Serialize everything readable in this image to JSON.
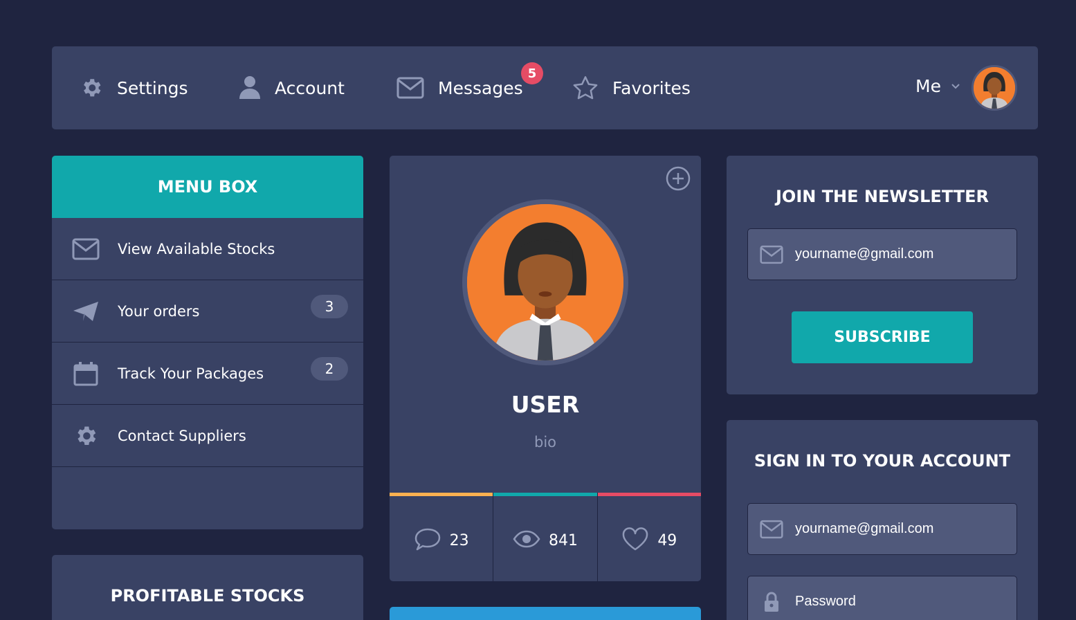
{
  "nav": {
    "settings_label": "Settings",
    "account_label": "Account",
    "messages_label": "Messages",
    "messages_badge": "5",
    "favorites_label": "Favorites",
    "me_label": "Me"
  },
  "menu_box": {
    "title": "MENU BOX",
    "items": [
      {
        "label": "View Available Stocks",
        "icon": "envelope-icon"
      },
      {
        "label": "Your orders",
        "icon": "paper-plane-icon",
        "count": "3"
      },
      {
        "label": "Track Your Packages",
        "icon": "calendar-icon",
        "count": "2"
      },
      {
        "label": "Contact Suppliers",
        "icon": "gear-icon"
      }
    ]
  },
  "profitable_stocks": {
    "title": "PROFITABLE STOCKS"
  },
  "profile": {
    "name": "USER",
    "bio": "bio",
    "stats": {
      "comments": "23",
      "views": "841",
      "likes": "49"
    }
  },
  "newsletter": {
    "title": "JOIN THE NEWSLETTER",
    "email_value": "yourname@gmail.com",
    "subscribe_label": "SUBSCRIBE"
  },
  "signin": {
    "title": "SIGN IN TO YOUR ACCOUNT",
    "email_value": "yourname@gmail.com",
    "password_value": "Password"
  },
  "colors": {
    "background": "#1f2440",
    "card": "#394264",
    "teal": "#11a8ab",
    "red": "#e64c65",
    "yellow": "#fcb150",
    "blue": "#2a9ad8",
    "field": "#50597b",
    "avatar_orange": "#f37e2f"
  }
}
